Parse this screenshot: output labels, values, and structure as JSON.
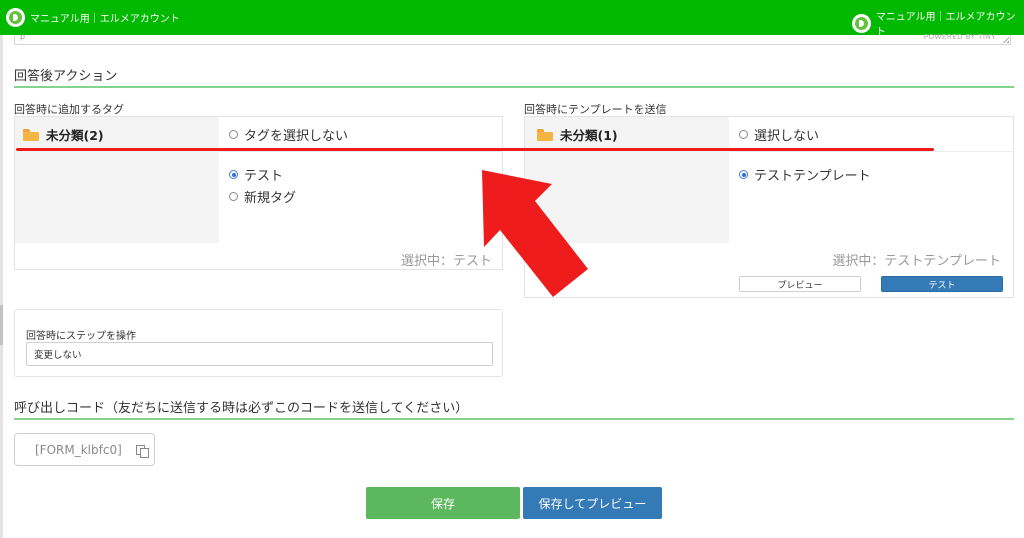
{
  "header": {
    "brand_left": "マニュアル用｜エルメアカウント",
    "brand_right": "マニュアル用｜エルメアカウント"
  },
  "editor": {
    "paragraph_tag": "p",
    "powered_by": "POWERED BY TINY"
  },
  "after_answer": {
    "title": "回答後アクション",
    "tag_panel": {
      "label": "回答時に追加するタグ",
      "folder_name": "未分類(2)",
      "options": [
        {
          "label": "タグを選択しない",
          "selected": false
        },
        {
          "label": "テスト",
          "selected": true
        },
        {
          "label": "新規タグ",
          "selected": false
        }
      ],
      "selected_text": "選択中：テスト"
    },
    "template_panel": {
      "label": "回答時にテンプレートを送信",
      "folder_name": "未分類(1)",
      "options": [
        {
          "label": "選択しない",
          "selected": false
        },
        {
          "label": "テストテンプレート",
          "selected": true
        }
      ],
      "selected_text": "選択中：テストテンプレート",
      "preview_button": "プレビュー",
      "test_button": "テスト"
    },
    "step": {
      "label": "回答時にステップを操作",
      "value": "変更しない"
    }
  },
  "call_code": {
    "title": "呼び出しコード（友だちに送信する時は必ずこのコードを送信してください）",
    "code": "[FORM_klbfc0]"
  },
  "actions": {
    "save": "保存",
    "save_and_preview": "保存してプレビュー"
  },
  "colors": {
    "header_green": "#00b900",
    "section_line": "#81d48a",
    "save_green": "#5cb85c",
    "primary_blue": "#337ab7",
    "annotation_red": "#ee1c1c"
  }
}
